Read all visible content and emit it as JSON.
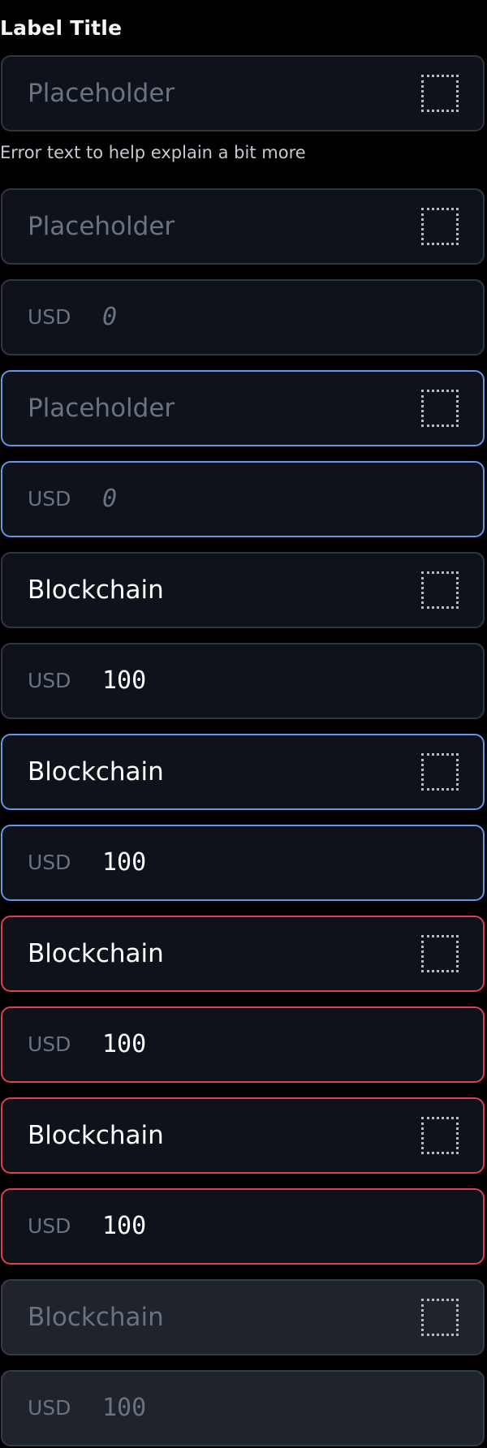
{
  "label_title": "Label Title",
  "helper_text": "Error text to help explain a bit more",
  "fields": [
    {
      "state": "default",
      "kind": "text",
      "value": "Placeholder",
      "is_placeholder": true,
      "icon": "placeholder-square-icon"
    },
    {
      "state": "default",
      "kind": "text",
      "value": "Placeholder",
      "is_placeholder": true,
      "icon": "placeholder-square-icon"
    },
    {
      "state": "default",
      "kind": "amount",
      "currency": "USD",
      "value": "0",
      "is_placeholder": true
    },
    {
      "state": "focus",
      "kind": "text",
      "value": "Placeholder",
      "is_placeholder": true,
      "icon": "placeholder-square-icon"
    },
    {
      "state": "focus",
      "kind": "amount",
      "currency": "USD",
      "value": "0",
      "is_placeholder": true
    },
    {
      "state": "filled",
      "kind": "text",
      "value": "Blockchain",
      "is_placeholder": false,
      "icon": "placeholder-square-icon"
    },
    {
      "state": "filled",
      "kind": "amount",
      "currency": "USD",
      "value": "100",
      "is_placeholder": false
    },
    {
      "state": "focus",
      "kind": "text",
      "value": "Blockchain",
      "is_placeholder": false,
      "icon": "placeholder-square-icon"
    },
    {
      "state": "focus",
      "kind": "amount",
      "currency": "USD",
      "value": "100",
      "is_placeholder": false
    },
    {
      "state": "error",
      "kind": "text",
      "value": "Blockchain",
      "is_placeholder": false,
      "icon": "placeholder-square-icon"
    },
    {
      "state": "error",
      "kind": "amount",
      "currency": "USD",
      "value": "100",
      "is_placeholder": false
    },
    {
      "state": "error",
      "kind": "text",
      "value": "Blockchain",
      "is_placeholder": false,
      "icon": "placeholder-square-icon"
    },
    {
      "state": "error",
      "kind": "amount",
      "currency": "USD",
      "value": "100",
      "is_placeholder": false
    },
    {
      "state": "disabled",
      "kind": "text",
      "value": "Blockchain",
      "is_placeholder": false,
      "icon": "placeholder-square-icon"
    },
    {
      "state": "disabled",
      "kind": "amount",
      "currency": "USD",
      "value": "100",
      "is_placeholder": false
    }
  ],
  "colors": {
    "background": "#000000",
    "field_background": "#0e121b",
    "default_border": "#30363d",
    "focus_border": "#5f98e6",
    "error_border": "#e23d49",
    "disabled_background": "#1f232b",
    "placeholder_text": "#6b7280"
  }
}
